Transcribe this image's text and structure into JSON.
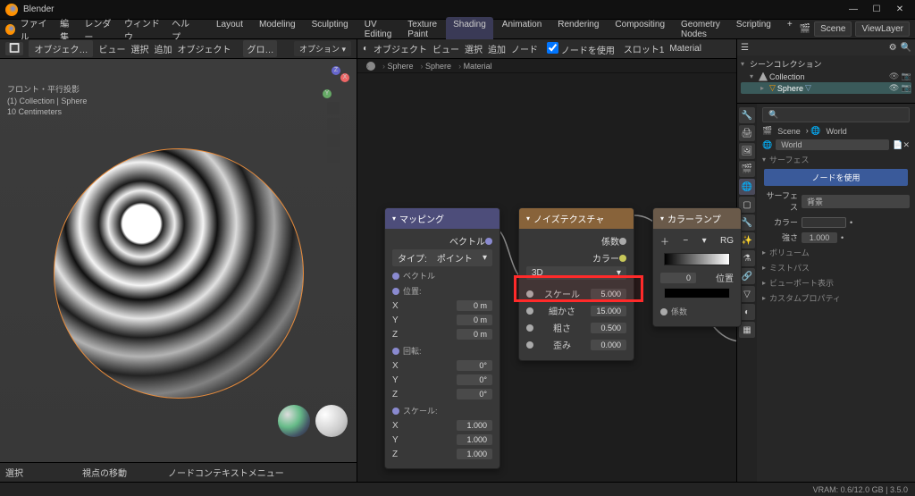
{
  "app": {
    "title": "Blender",
    "menus": [
      "ファイル",
      "編集",
      "レンダー",
      "ウィンドウ",
      "ヘルプ"
    ],
    "tabs": [
      "Layout",
      "Modeling",
      "Sculpting",
      "UV Editing",
      "Texture Paint",
      "Shading",
      "Animation",
      "Rendering",
      "Compositing",
      "Geometry Nodes",
      "Scripting",
      "+"
    ],
    "active_tab": "Shading",
    "scene": "Scene",
    "viewlayer": "ViewLayer"
  },
  "viewport": {
    "toolbar": {
      "view": "ビュー",
      "select": "選択",
      "add": "追加",
      "object": "オブジェクト",
      "mode": "オブジェク…",
      "global": "グロ…",
      "options": "オプション ▾"
    },
    "info": {
      "l1": "フロント・平行投影",
      "l2": "(1) Collection | Sphere",
      "l3": "10 Centimeters"
    },
    "footer": {
      "select": "選択",
      "move_view": "視点の移動",
      "context": "ノードコンテキストメニュー"
    }
  },
  "node_editor": {
    "toolbar": {
      "object": "オブジェクト",
      "view": "ビュー",
      "select": "選択",
      "add": "追加",
      "node": "ノード",
      "use_nodes": "ノードを使用",
      "slot": "スロット1",
      "material": "Material"
    },
    "breadcrumb": [
      "Sphere",
      "Sphere",
      "Material"
    ],
    "mapping": {
      "title": "マッピング",
      "out_vector": "ベクトル",
      "type_label": "タイプ:",
      "type_value": "ポイント",
      "vector": "ベクトル",
      "location": "位置:",
      "rotation": "回転:",
      "scale": "スケール:",
      "loc": {
        "x": "X",
        "y": "Y",
        "z": "Z",
        "xv": "0 m",
        "yv": "0 m",
        "zv": "0 m"
      },
      "rot": {
        "x": "X",
        "y": "Y",
        "z": "Z",
        "xv": "0°",
        "yv": "0°",
        "zv": "0°"
      },
      "scl": {
        "x": "X",
        "y": "Y",
        "z": "Z",
        "xv": "1.000",
        "yv": "1.000",
        "zv": "1.000"
      }
    },
    "noise": {
      "title": "ノイズテクスチャ",
      "fac": "係数",
      "color": "カラー",
      "dim": "3D",
      "scale_lbl": "スケール",
      "scale_val": "5.000",
      "detail_lbl": "細かさ",
      "detail_val": "15.000",
      "rough_lbl": "粗さ",
      "rough_val": "0.500",
      "distort_lbl": "歪み",
      "distort_val": "0.000"
    },
    "colorramp": {
      "title": "カラーランプ",
      "fac": "係数",
      "rgb_label": "RG",
      "pos_label": "位置",
      "pos_val": "0"
    }
  },
  "outliner": {
    "title": "シーンコレクション",
    "collection": "Collection",
    "item": "Sphere"
  },
  "properties": {
    "search_placeholder": "",
    "scene_crumb": "Scene",
    "world_crumb": "World",
    "world_field": "World",
    "surface_sec": "サーフェス",
    "use_nodes": "ノードを使用",
    "surface_lbl": "サーフェス",
    "surface_val": "背景",
    "color_lbl": "カラー",
    "strength_lbl": "強さ",
    "strength_val": "1.000",
    "volume_sec": "ボリューム",
    "mist_sec": "ミストパス",
    "viewport_sec": "ビューポート表示",
    "custom_sec": "カスタムプロパティ"
  },
  "status": {
    "vram": "VRAM: 0.6/12.0 GB | 3.5.0"
  },
  "chart_data": null
}
